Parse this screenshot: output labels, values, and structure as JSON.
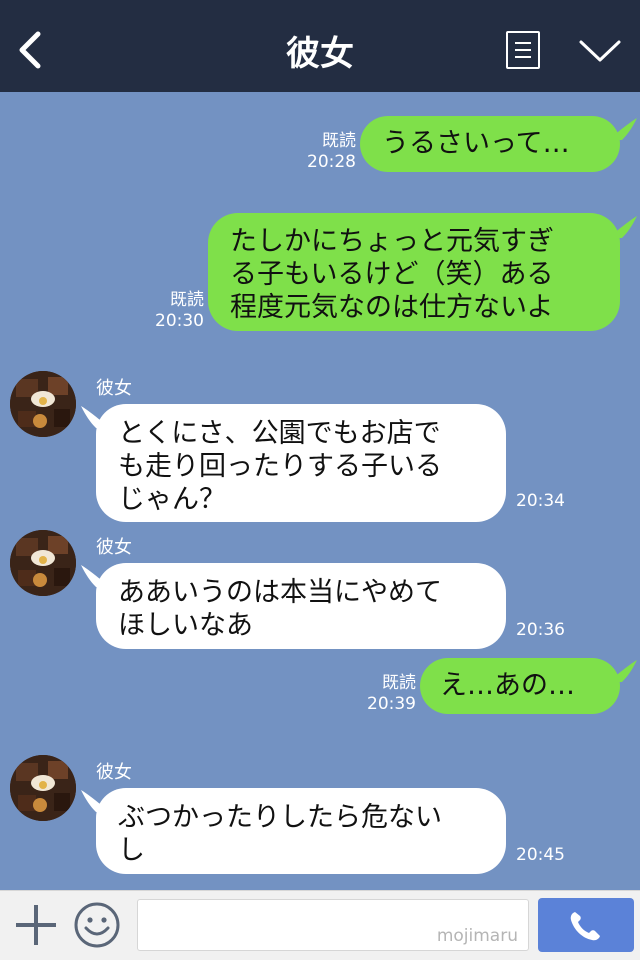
{
  "header": {
    "title": "彼女"
  },
  "messages": [
    {
      "side": "out",
      "text": "うるさいって…",
      "read": "既読",
      "time": "20:28"
    },
    {
      "side": "out",
      "text_lines": [
        "たしかにちょっと元気すぎ",
        "る子もいるけど（笑）ある",
        "程度元気なのは仕方ないよ"
      ],
      "read": "既読",
      "time": "20:30"
    },
    {
      "side": "in",
      "sender": "彼女",
      "text_lines": [
        "とくにさ、公園でもお店で",
        "も走り回ったりする子いる",
        "じゃん？"
      ],
      "time": "20:34"
    },
    {
      "side": "in",
      "sender": "彼女",
      "text_lines": [
        "ああいうのは本当にやめて",
        "ほしいなあ"
      ],
      "time": "20:36"
    },
    {
      "side": "out",
      "text": "え…あの…",
      "read": "既読",
      "time": "20:39"
    },
    {
      "side": "in",
      "sender": "彼女",
      "text_lines": [
        "ぶつかったりしたら危ない",
        "し"
      ],
      "time": "20:45"
    }
  ],
  "input": {
    "watermark": "mojimaru"
  },
  "colors": {
    "header": "#232d42",
    "chat_bg": "#7392c2",
    "bubble_out": "#7fe04a",
    "bubble_in": "#ffffff",
    "call_button": "#5b82d8"
  }
}
